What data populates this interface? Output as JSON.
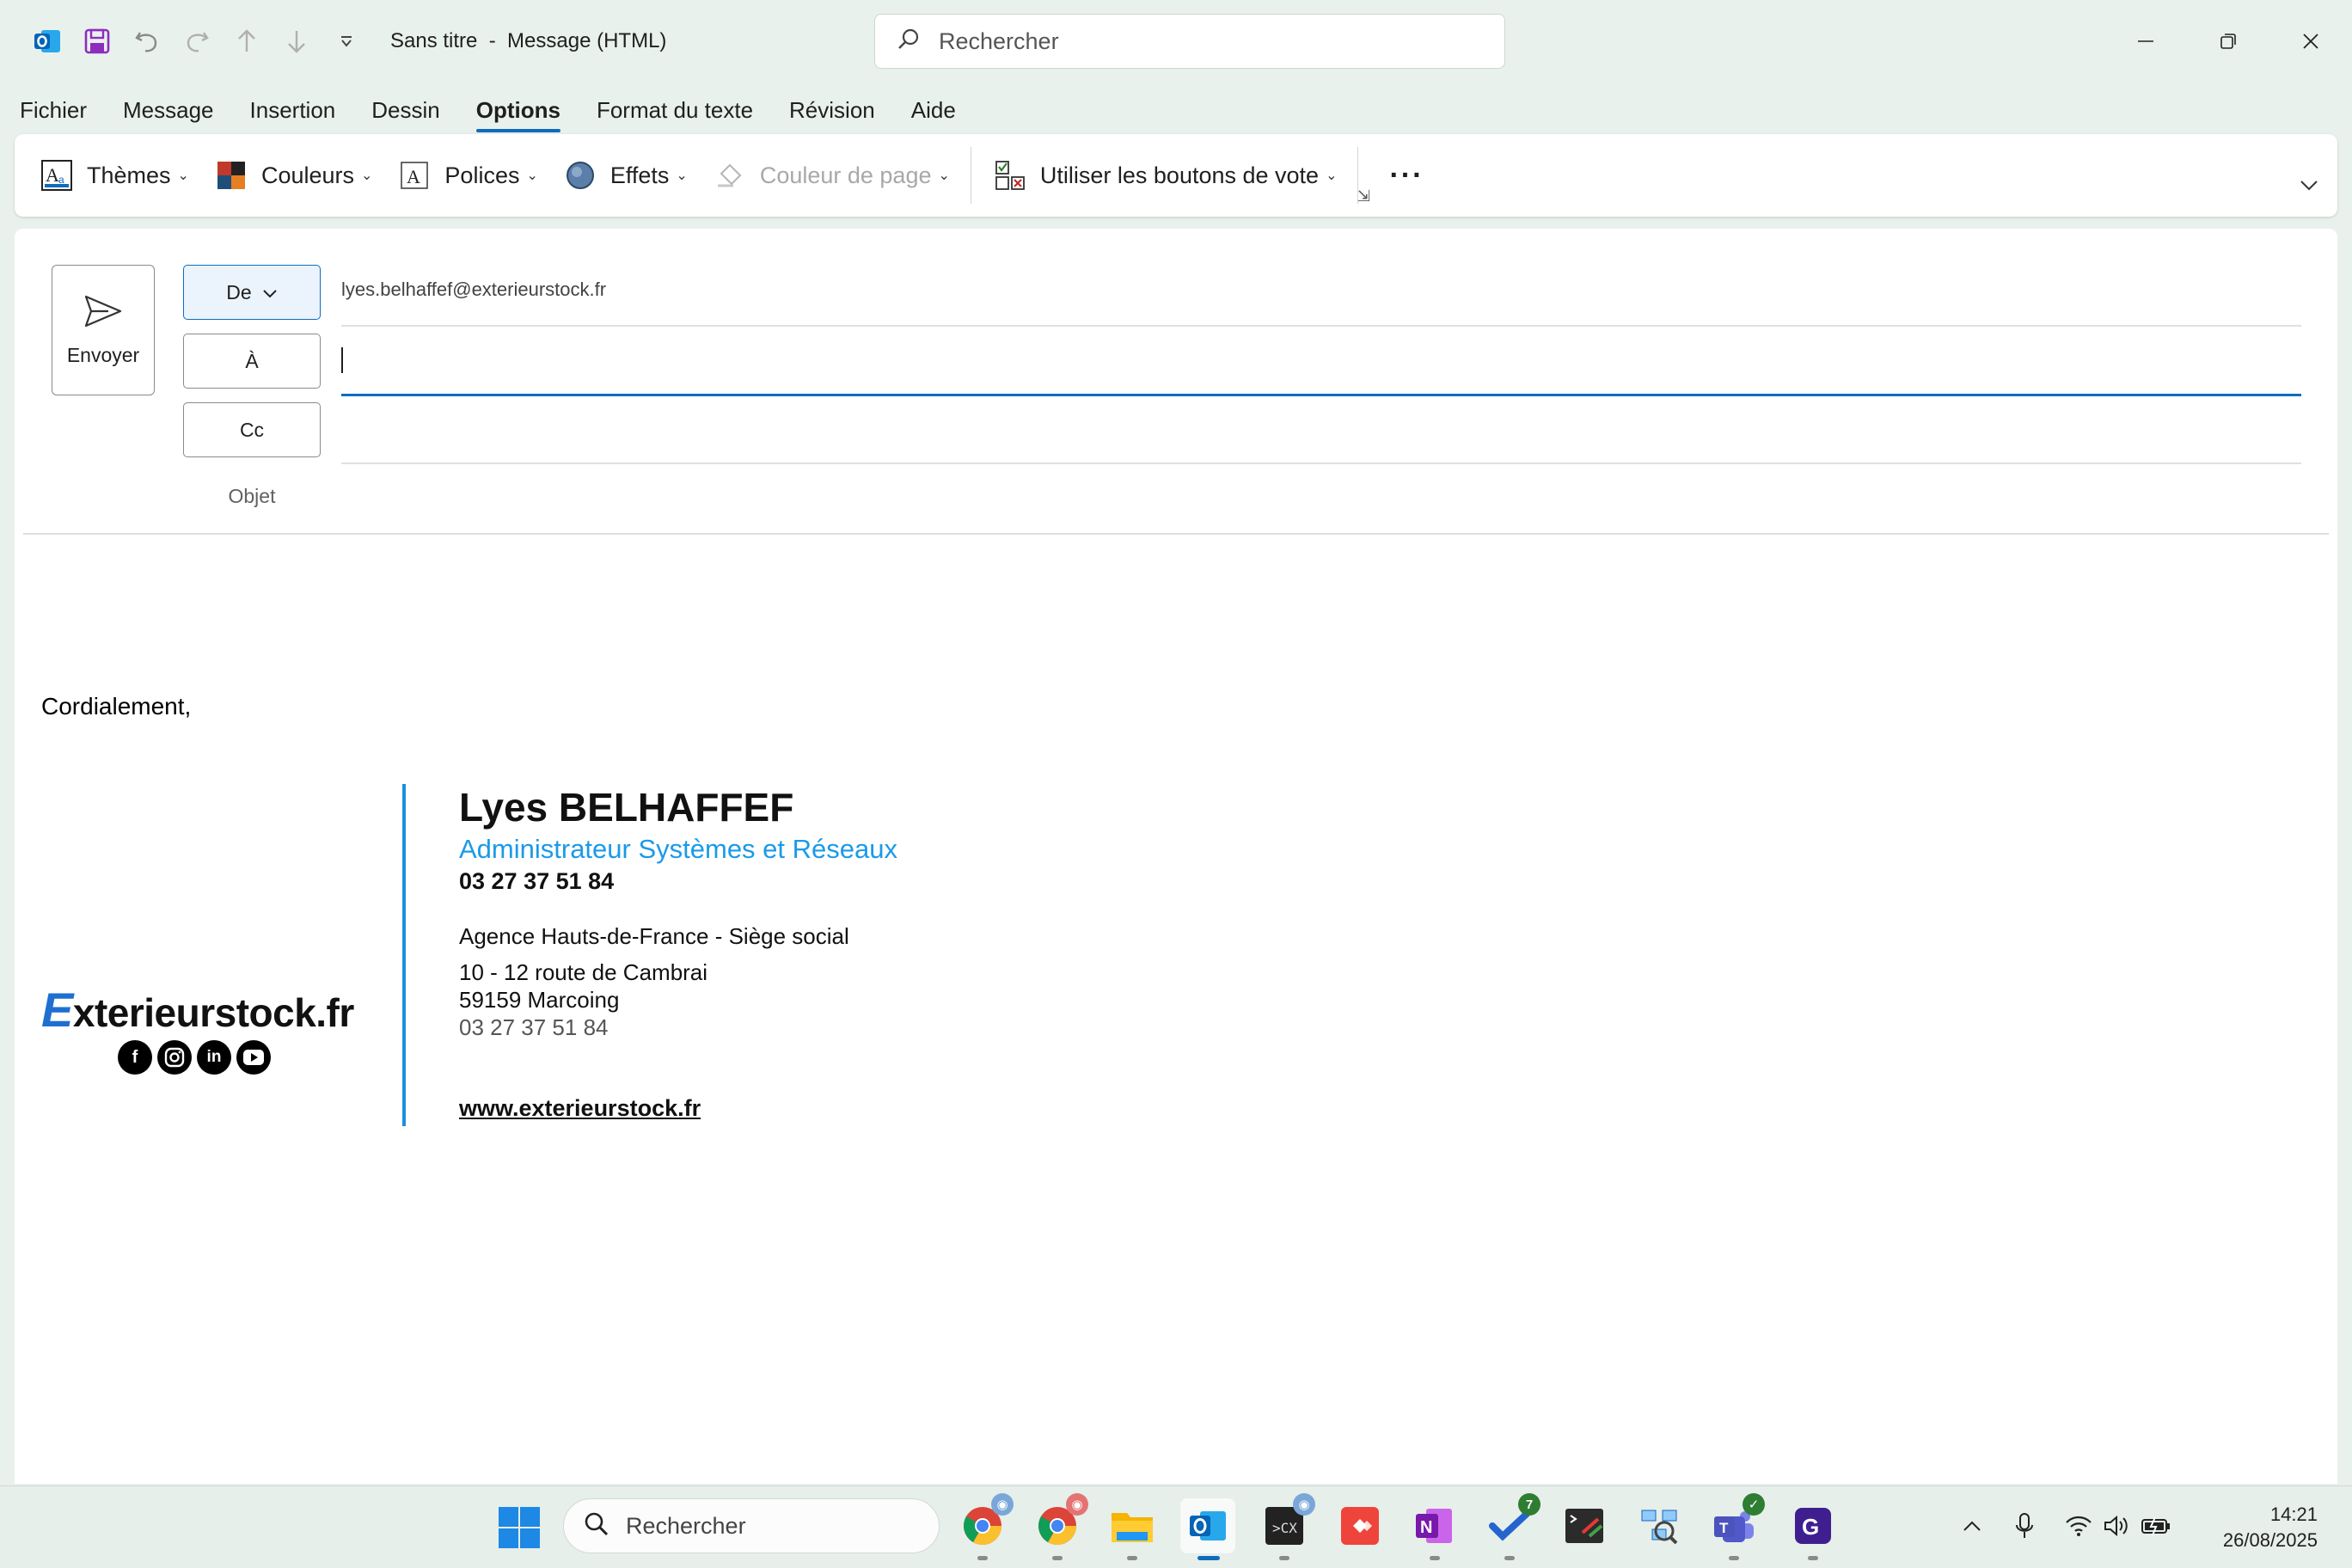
{
  "window": {
    "title": "Sans titre  -  Message (HTML)",
    "search_placeholder": "Rechercher"
  },
  "menu": {
    "tabs": [
      {
        "label": "Fichier"
      },
      {
        "label": "Message"
      },
      {
        "label": "Insertion"
      },
      {
        "label": "Dessin"
      },
      {
        "label": "Options",
        "active": true
      },
      {
        "label": "Format du texte"
      },
      {
        "label": "Révision"
      },
      {
        "label": "Aide"
      }
    ]
  },
  "ribbon": {
    "themes": "Thèmes",
    "colors": "Couleurs",
    "fonts": "Polices",
    "effects": "Effets",
    "page_color": "Couleur de page",
    "voting": "Utiliser les boutons de vote",
    "more": "···"
  },
  "compose": {
    "send_label": "Envoyer",
    "from_label": "De",
    "to_label": "À",
    "cc_label": "Cc",
    "subject_label": "Objet",
    "from_value": "lyes.belhaffef@exterieurstock.fr",
    "to_value": "",
    "cc_value": "",
    "subject_value": ""
  },
  "body": {
    "closing": "Cordialement,"
  },
  "signature": {
    "logo_initial": "E",
    "logo_rest": "xterieurstock.fr",
    "name": "Lyes BELHAFFEF",
    "role": "Administrateur Systèmes et Réseaux",
    "phone_direct": "03 27 37 51 84",
    "agency": "Agence Hauts-de-France - Siège social",
    "address_line1": "10 - 12 route de Cambrai",
    "address_line2": "59159 Marcoing",
    "phone_agency": "03 27 37 51 84",
    "website": "www.exterieurstock.fr",
    "socials": [
      "facebook-icon",
      "instagram-icon",
      "linkedin-icon",
      "youtube-icon"
    ]
  },
  "taskbar": {
    "search_placeholder": "Rechercher",
    "todo_badge": "7",
    "time": "14:21",
    "date": "26/08/2025"
  },
  "colors": {
    "accent": "#0f6cbd",
    "signature_blue": "#1a9ae8",
    "background": "#e9f1ec"
  }
}
